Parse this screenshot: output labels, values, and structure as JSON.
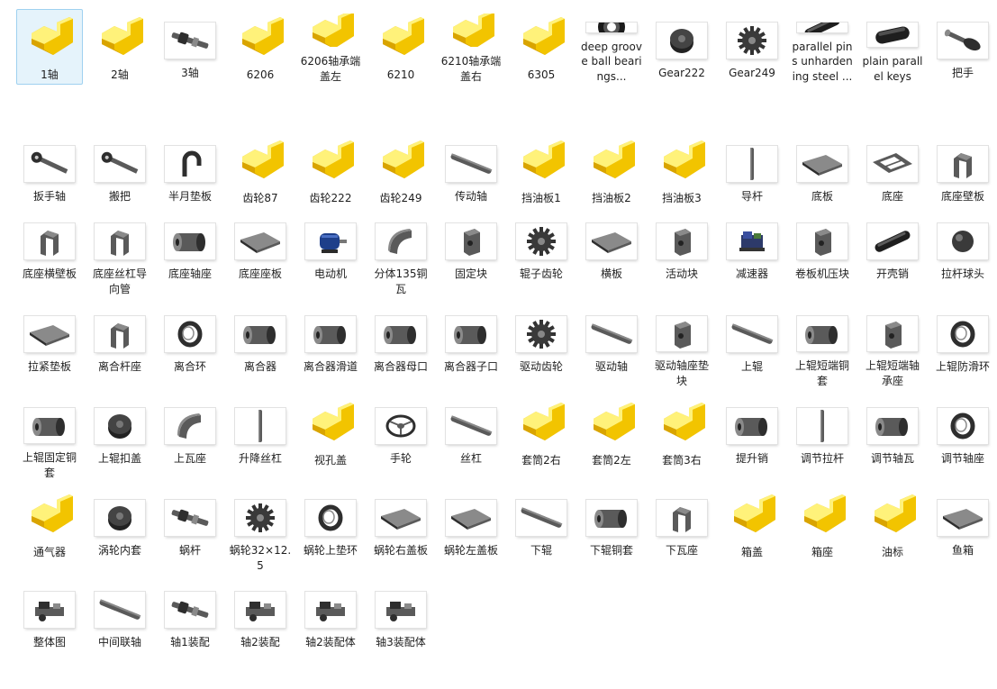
{
  "colors": {
    "selection_bg": "#e5f3fb",
    "selection_border": "#9fd1f0",
    "folder": "#f7cf16",
    "part": "#5a5a5a",
    "motor": "#1e3f8a"
  },
  "items": [
    {
      "label": "1轴",
      "icon": "folder-icon",
      "selected": true
    },
    {
      "label": "2轴",
      "icon": "folder-icon"
    },
    {
      "label": "3轴",
      "icon": "shaft-icon"
    },
    {
      "label": "6206",
      "icon": "folder-icon"
    },
    {
      "label": "6206轴承端盖左",
      "icon": "folder-icon"
    },
    {
      "label": "6210",
      "icon": "folder-icon"
    },
    {
      "label": "6210轴承端盖右",
      "icon": "folder-icon"
    },
    {
      "label": "6305",
      "icon": "folder-icon"
    },
    {
      "label": "deep groove ball bearings...",
      "icon": "bearing-icon"
    },
    {
      "label": "Gear222",
      "icon": "disc-icon"
    },
    {
      "label": "Gear249",
      "icon": "gear-icon"
    },
    {
      "label": "parallel pins unhardening steel ...",
      "icon": "pin-icon"
    },
    {
      "label": "plain parallel keys",
      "icon": "key-icon"
    },
    {
      "label": "把手",
      "icon": "handle-icon"
    },
    {
      "label": "扳手轴",
      "icon": "lever-icon"
    },
    {
      "label": "搬把",
      "icon": "lever-icon"
    },
    {
      "label": "半月垫板",
      "icon": "hook-icon"
    },
    {
      "label": "齿轮87",
      "icon": "folder-icon"
    },
    {
      "label": "齿轮222",
      "icon": "folder-icon"
    },
    {
      "label": "齿轮249",
      "icon": "folder-icon"
    },
    {
      "label": "传动轴",
      "icon": "rod-icon"
    },
    {
      "label": "挡油板1",
      "icon": "folder-icon"
    },
    {
      "label": "挡油板2",
      "icon": "folder-icon"
    },
    {
      "label": "挡油板3",
      "icon": "folder-icon"
    },
    {
      "label": "导杆",
      "icon": "vertical-rod-icon"
    },
    {
      "label": "底板",
      "icon": "plate-icon"
    },
    {
      "label": "底座",
      "icon": "frame-icon"
    },
    {
      "label": "底座壁板",
      "icon": "bracket-icon"
    },
    {
      "label": "底座横壁板",
      "icon": "bracket-icon"
    },
    {
      "label": "底座丝杠导向管",
      "icon": "bracket-icon"
    },
    {
      "label": "底座轴座",
      "icon": "cylinder-icon"
    },
    {
      "label": "底座座板",
      "icon": "plate-icon"
    },
    {
      "label": "电动机",
      "icon": "motor-icon"
    },
    {
      "label": "分体135铜瓦",
      "icon": "shell-icon"
    },
    {
      "label": "固定块",
      "icon": "block-icon"
    },
    {
      "label": "辊子齿轮",
      "icon": "gear-icon"
    },
    {
      "label": "横板",
      "icon": "plate-icon"
    },
    {
      "label": "活动块",
      "icon": "block-icon"
    },
    {
      "label": "减速器",
      "icon": "reducer-icon"
    },
    {
      "label": "卷板机压块",
      "icon": "block-icon"
    },
    {
      "label": "开壳销",
      "icon": "pin-icon"
    },
    {
      "label": "拉杆球头",
      "icon": "ball-icon"
    },
    {
      "label": "拉紧垫板",
      "icon": "plate-icon"
    },
    {
      "label": "离合杆座",
      "icon": "bracket-icon"
    },
    {
      "label": "离合环",
      "icon": "ring-icon"
    },
    {
      "label": "离合器",
      "icon": "cylinder-icon"
    },
    {
      "label": "离合器滑道",
      "icon": "cylinder-icon"
    },
    {
      "label": "离合器母口",
      "icon": "cylinder-icon"
    },
    {
      "label": "离合器子口",
      "icon": "cylinder-icon"
    },
    {
      "label": "驱动齿轮",
      "icon": "gear-icon"
    },
    {
      "label": "驱动轴",
      "icon": "rod-icon"
    },
    {
      "label": "驱动轴座垫块",
      "icon": "block-icon"
    },
    {
      "label": "上辊",
      "icon": "rod-icon"
    },
    {
      "label": "上辊短端铜套",
      "icon": "cylinder-icon"
    },
    {
      "label": "上辊短端轴承座",
      "icon": "block-icon"
    },
    {
      "label": "上辊防滑环",
      "icon": "ring-icon"
    },
    {
      "label": "上辊固定铜套",
      "icon": "cylinder-icon"
    },
    {
      "label": "上辊扣盖",
      "icon": "disc-icon"
    },
    {
      "label": "上瓦座",
      "icon": "shell-icon"
    },
    {
      "label": "升降丝杠",
      "icon": "vertical-rod-icon"
    },
    {
      "label": "视孔盖",
      "icon": "folder-icon"
    },
    {
      "label": "手轮",
      "icon": "wheel-icon"
    },
    {
      "label": "丝杠",
      "icon": "rod-icon"
    },
    {
      "label": "套筒2右",
      "icon": "folder-icon"
    },
    {
      "label": "套筒2左",
      "icon": "folder-icon"
    },
    {
      "label": "套筒3右",
      "icon": "folder-icon"
    },
    {
      "label": "提升销",
      "icon": "cylinder-icon"
    },
    {
      "label": "调节拉杆",
      "icon": "vertical-rod-icon"
    },
    {
      "label": "调节轴瓦",
      "icon": "cylinder-icon"
    },
    {
      "label": "调节轴座",
      "icon": "ring-icon"
    },
    {
      "label": "通气器",
      "icon": "folder-icon"
    },
    {
      "label": "涡轮内套",
      "icon": "disc-icon"
    },
    {
      "label": "蜗杆",
      "icon": "shaft-icon"
    },
    {
      "label": "蜗轮32×12.5",
      "icon": "gear-icon"
    },
    {
      "label": "蜗轮上垫环",
      "icon": "ring-icon"
    },
    {
      "label": "蜗轮右盖板",
      "icon": "plate-icon"
    },
    {
      "label": "蜗轮左盖板",
      "icon": "plate-icon"
    },
    {
      "label": "下辊",
      "icon": "rod-icon"
    },
    {
      "label": "下辊铜套",
      "icon": "cylinder-icon"
    },
    {
      "label": "下瓦座",
      "icon": "bracket-icon"
    },
    {
      "label": "箱盖",
      "icon": "folder-icon"
    },
    {
      "label": "箱座",
      "icon": "folder-icon"
    },
    {
      "label": "油标",
      "icon": "folder-icon"
    },
    {
      "label": "鱼箱",
      "icon": "plate-icon"
    },
    {
      "label": "整体图",
      "icon": "assembly-icon"
    },
    {
      "label": "中间联轴",
      "icon": "rod-icon"
    },
    {
      "label": "轴1装配",
      "icon": "shaft-icon"
    },
    {
      "label": "轴2装配",
      "icon": "assembly-icon"
    },
    {
      "label": "轴2装配体",
      "icon": "assembly-icon"
    },
    {
      "label": "轴3装配体",
      "icon": "assembly-icon"
    }
  ]
}
